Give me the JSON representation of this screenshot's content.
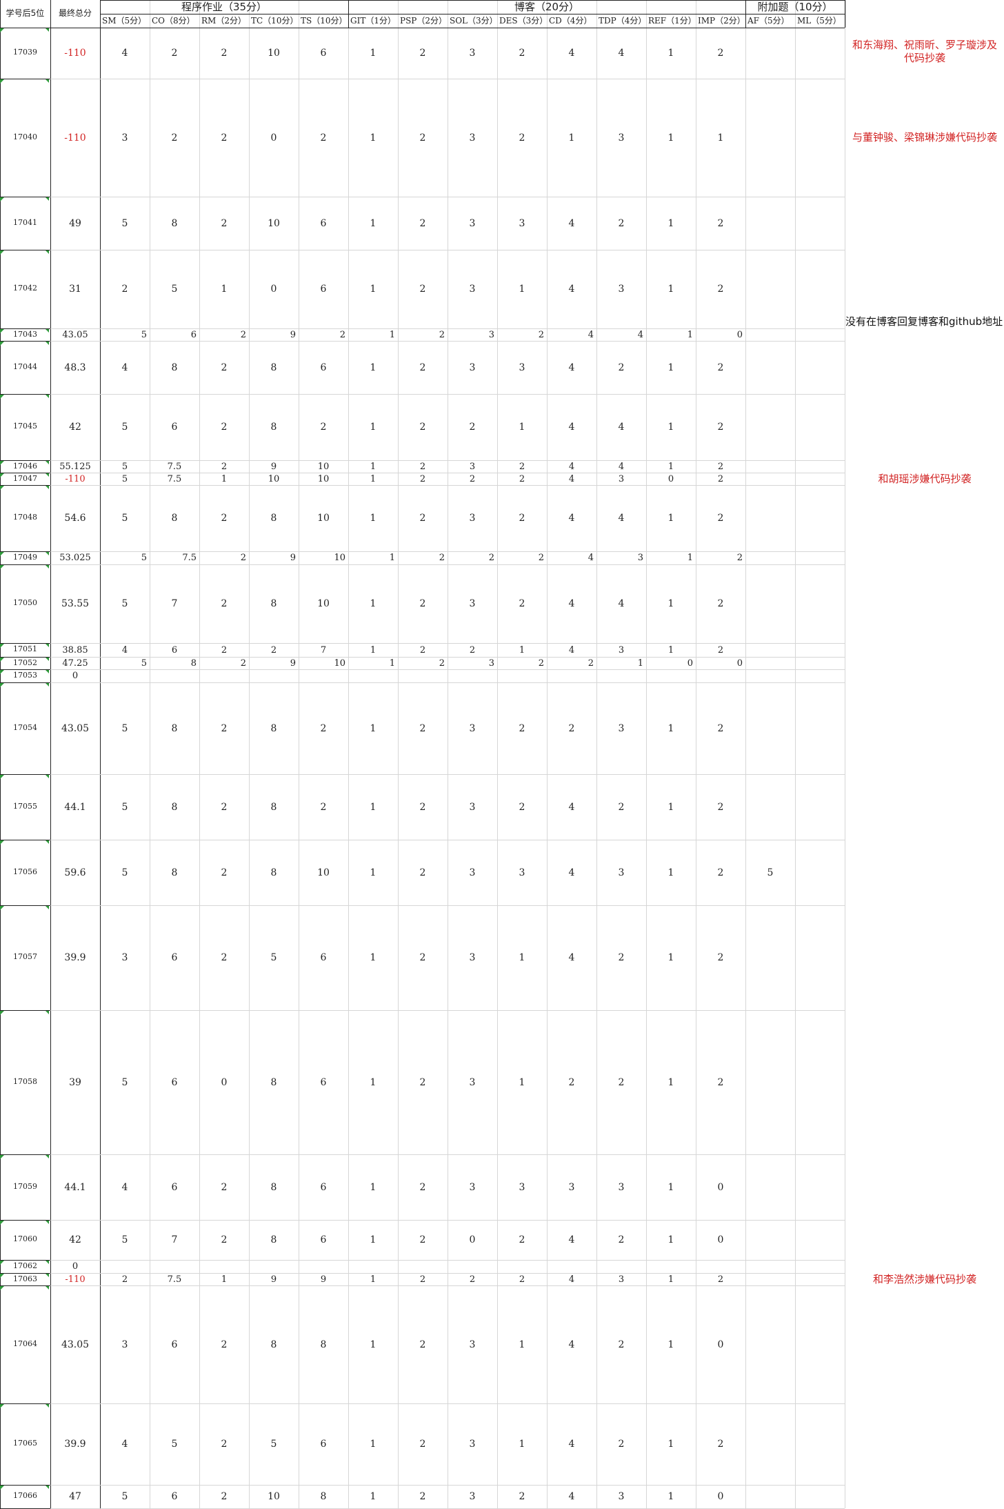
{
  "sheet": {
    "header": {
      "id_col": "学号后5位",
      "total_col": "最终总分",
      "groups": [
        "程序作业（35分）",
        "博客（20分）",
        "附加题（10分）"
      ],
      "sub": [
        "SM（5分）",
        "CO（8分）",
        "RM（2分）",
        "TC（10分）",
        "TS（10分）",
        "GIT（1分）",
        "PSP（2分）",
        "SOL（3分）",
        "DES（3分）",
        "CD（4分）",
        "TDP（4分）",
        "REF（1分）",
        "IMP（2分）",
        "AF（5分）",
        "ML（5分）"
      ]
    },
    "rows": [
      {
        "id": "17039",
        "total": "-110",
        "s": [
          "4",
          "2",
          "2",
          "10",
          "6",
          "1",
          "2",
          "3",
          "2",
          "4",
          "4",
          "1",
          "2",
          "",
          ""
        ],
        "note": "和东海翔、祝雨昕、罗子璇涉及代码抄袭"
      },
      {
        "id": "17040",
        "total": "-110",
        "s": [
          "3",
          "2",
          "2",
          "0",
          "2",
          "1",
          "2",
          "3",
          "2",
          "1",
          "3",
          "1",
          "1",
          "",
          ""
        ],
        "note": "与董钟骏、梁锦琳涉嫌代码抄袭"
      },
      {
        "id": "17041",
        "total": "49",
        "s": [
          "5",
          "8",
          "2",
          "10",
          "6",
          "1",
          "2",
          "3",
          "3",
          "4",
          "2",
          "1",
          "2",
          "",
          ""
        ]
      },
      {
        "id": "17042",
        "total": "31",
        "s": [
          "2",
          "5",
          "1",
          "0",
          "6",
          "1",
          "2",
          "3",
          "1",
          "4",
          "3",
          "1",
          "2",
          "",
          ""
        ]
      },
      {
        "id": "17043",
        "total": "43.05",
        "s": [
          "5",
          "6",
          "2",
          "9",
          "2",
          "1",
          "2",
          "3",
          "2",
          "4",
          "4",
          "1",
          "0",
          "",
          ""
        ],
        "note": "没有在博客回复博客和github地址"
      },
      {
        "id": "17044",
        "total": "48.3",
        "s": [
          "4",
          "8",
          "2",
          "8",
          "6",
          "1",
          "2",
          "3",
          "3",
          "4",
          "2",
          "1",
          "2",
          "",
          ""
        ]
      },
      {
        "id": "17045",
        "total": "42",
        "s": [
          "5",
          "6",
          "2",
          "8",
          "2",
          "1",
          "2",
          "2",
          "1",
          "4",
          "4",
          "1",
          "2",
          "",
          ""
        ]
      },
      {
        "id": "17046",
        "total": "55.125",
        "s": [
          "5",
          "7.5",
          "2",
          "9",
          "10",
          "1",
          "2",
          "3",
          "2",
          "4",
          "4",
          "1",
          "2",
          "",
          ""
        ]
      },
      {
        "id": "17047",
        "total": "-110",
        "s": [
          "5",
          "7.5",
          "1",
          "10",
          "10",
          "1",
          "2",
          "2",
          "2",
          "4",
          "3",
          "0",
          "2",
          "",
          ""
        ],
        "note": "和胡瑶涉嫌代码抄袭"
      },
      {
        "id": "17048",
        "total": "54.6",
        "s": [
          "5",
          "8",
          "2",
          "8",
          "10",
          "1",
          "2",
          "3",
          "2",
          "4",
          "4",
          "1",
          "2",
          "",
          ""
        ]
      },
      {
        "id": "17049",
        "total": "53.025",
        "s": [
          "5",
          "7.5",
          "2",
          "9",
          "10",
          "1",
          "2",
          "2",
          "2",
          "4",
          "3",
          "1",
          "2",
          "",
          ""
        ]
      },
      {
        "id": "17050",
        "total": "53.55",
        "s": [
          "5",
          "7",
          "2",
          "8",
          "10",
          "1",
          "2",
          "3",
          "2",
          "4",
          "4",
          "1",
          "2",
          "",
          ""
        ]
      },
      {
        "id": "17051",
        "total": "38.85",
        "s": [
          "4",
          "6",
          "2",
          "2",
          "7",
          "1",
          "2",
          "2",
          "1",
          "4",
          "3",
          "1",
          "2",
          "",
          ""
        ]
      },
      {
        "id": "17052",
        "total": "47.25",
        "s": [
          "5",
          "8",
          "2",
          "9",
          "10",
          "1",
          "2",
          "3",
          "2",
          "2",
          "1",
          "0",
          "0",
          "",
          ""
        ]
      },
      {
        "id": "17053",
        "total": "0",
        "s": [
          "",
          "",
          "",
          "",
          "",
          "",
          "",
          "",
          "",
          "",
          "",
          "",
          "",
          "",
          ""
        ]
      },
      {
        "id": "17054",
        "total": "43.05",
        "s": [
          "5",
          "8",
          "2",
          "8",
          "2",
          "1",
          "2",
          "3",
          "2",
          "2",
          "3",
          "1",
          "2",
          "",
          ""
        ]
      },
      {
        "id": "17055",
        "total": "44.1",
        "s": [
          "5",
          "8",
          "2",
          "8",
          "2",
          "1",
          "2",
          "3",
          "2",
          "4",
          "2",
          "1",
          "2",
          "",
          ""
        ]
      },
      {
        "id": "17056",
        "total": "59.6",
        "s": [
          "5",
          "8",
          "2",
          "8",
          "10",
          "1",
          "2",
          "3",
          "3",
          "4",
          "3",
          "1",
          "2",
          "5",
          ""
        ]
      },
      {
        "id": "17057",
        "total": "39.9",
        "s": [
          "3",
          "6",
          "2",
          "5",
          "6",
          "1",
          "2",
          "3",
          "1",
          "4",
          "2",
          "1",
          "2",
          "",
          ""
        ]
      },
      {
        "id": "17058",
        "total": "39",
        "s": [
          "5",
          "6",
          "0",
          "8",
          "6",
          "1",
          "2",
          "3",
          "1",
          "2",
          "2",
          "1",
          "2",
          "",
          ""
        ]
      },
      {
        "id": "17059",
        "total": "44.1",
        "s": [
          "4",
          "6",
          "2",
          "8",
          "6",
          "1",
          "2",
          "3",
          "3",
          "3",
          "3",
          "1",
          "0",
          "",
          ""
        ]
      },
      {
        "id": "17060",
        "total": "42",
        "s": [
          "5",
          "7",
          "2",
          "8",
          "6",
          "1",
          "2",
          "0",
          "2",
          "4",
          "2",
          "1",
          "0",
          "",
          ""
        ]
      },
      {
        "id": "17062",
        "total": "0",
        "s": [
          "",
          "",
          "",
          "",
          "",
          "",
          "",
          "",
          "",
          "",
          "",
          "",
          "",
          "",
          ""
        ]
      },
      {
        "id": "17063",
        "total": "-110",
        "s": [
          "2",
          "7.5",
          "1",
          "9",
          "9",
          "1",
          "2",
          "2",
          "2",
          "4",
          "3",
          "1",
          "2",
          "",
          ""
        ],
        "note": "和李浩然涉嫌代码抄袭"
      },
      {
        "id": "17064",
        "total": "43.05",
        "s": [
          "3",
          "6",
          "2",
          "8",
          "8",
          "1",
          "2",
          "3",
          "1",
          "4",
          "2",
          "1",
          "0",
          "",
          ""
        ]
      },
      {
        "id": "17065",
        "total": "39.9",
        "s": [
          "4",
          "5",
          "2",
          "5",
          "6",
          "1",
          "2",
          "3",
          "1",
          "4",
          "2",
          "1",
          "2",
          "",
          ""
        ]
      },
      {
        "id": "17066",
        "total": "47",
        "s": [
          "5",
          "6",
          "2",
          "10",
          "8",
          "1",
          "2",
          "3",
          "2",
          "4",
          "3",
          "1",
          "0",
          "",
          ""
        ]
      }
    ]
  },
  "colors": {
    "grid": "#d6d6d6",
    "negative": "#d22424",
    "note": "#d22424",
    "corner_mark": "#2e9a3a"
  }
}
